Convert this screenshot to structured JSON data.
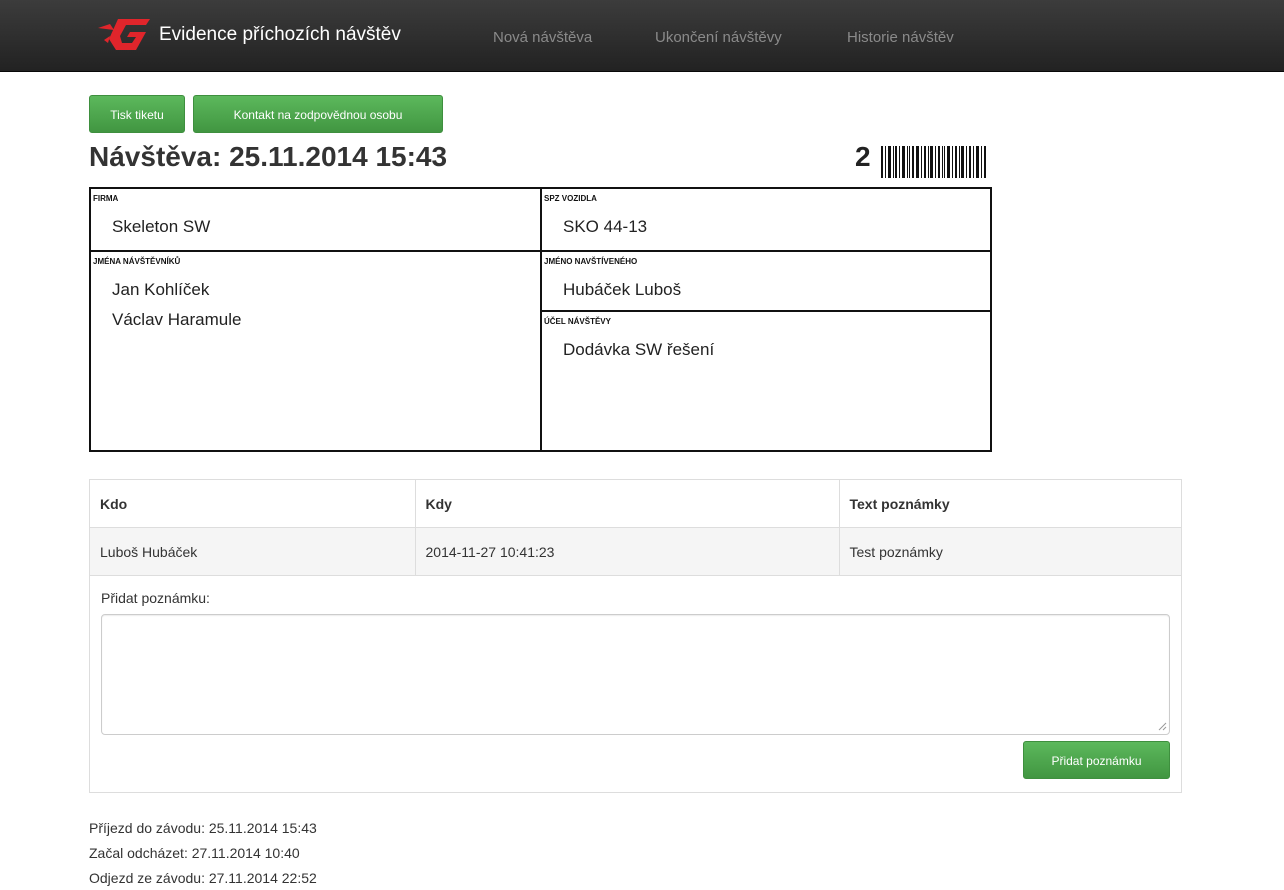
{
  "navbar": {
    "brand": "Evidence příchozích návštěv",
    "links": [
      "Nová návštěva",
      "Ukončení návštěvy",
      "Historie návštěv"
    ]
  },
  "toolbar": {
    "print_label": "Tisk tiketu",
    "contact_label": "Kontakt na zodpovědnou osobu"
  },
  "visit": {
    "title": "Návštěva: 25.11.2014 15:43",
    "ticket_number": "2",
    "company_label": "FIRMA",
    "company": "Skeleton SW",
    "plate_label": "SPZ VOZIDLA",
    "plate": "SKO 44-13",
    "visitors_label": "JMÉNA NÁVŠTĚVNÍKŮ",
    "visitors": [
      "Jan Kohlíček",
      "Václav Haramule"
    ],
    "host_label": "JMÉNO NAVŠTÍVENÉHO",
    "host": "Hubáček Luboš",
    "purpose_label": "ÚČEL NÁVŠTĚVY",
    "purpose": "Dodávka SW řešení"
  },
  "notes": {
    "columns": [
      "Kdo",
      "Kdy",
      "Text poznámky"
    ],
    "rows": [
      [
        "Luboš Hubáček",
        "2014-11-27 10:41:23",
        "Test poznámky"
      ]
    ],
    "add_label": "Přidat poznámku:",
    "textarea_value": "",
    "add_button": "Přidat poznámku"
  },
  "timeline": {
    "arrival": "Příjezd do závodu: 25.11.2014 15:43",
    "leaving_start": "Začal odcházet: 27.11.2014 10:40",
    "departure": "Odjezd ze závodu: 27.11.2014 22:52"
  },
  "colors": {
    "navbar": "#222222",
    "brand_logo": "#e0252b",
    "button_green": "#4cae4c"
  },
  "icons": {
    "brand": "brand-logo-icon",
    "barcode": "barcode-icon",
    "resize": "resize-grip-icon"
  }
}
